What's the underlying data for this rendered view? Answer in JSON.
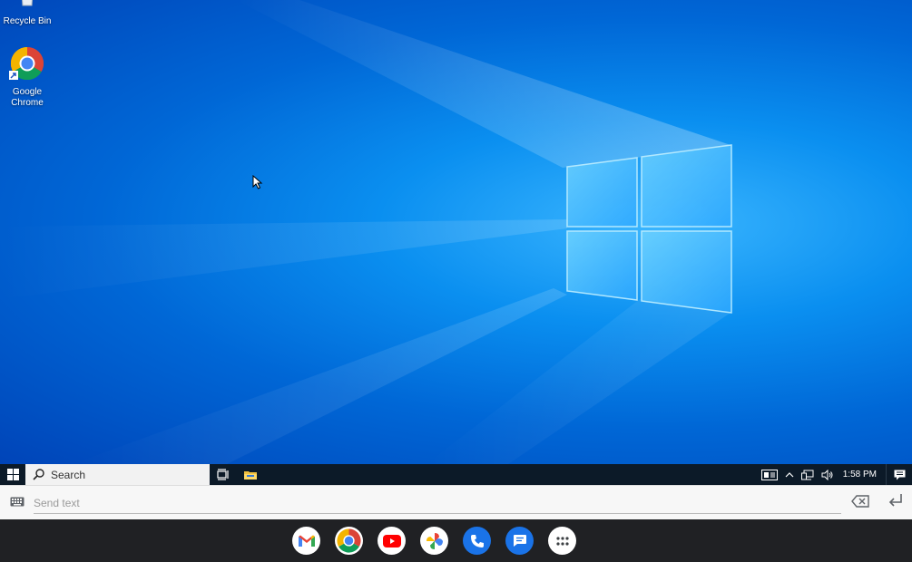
{
  "desktop": {
    "icons": [
      {
        "label": "Recycle Bin",
        "icon": "recycle-bin-icon"
      },
      {
        "label": "Google\nChrome",
        "icon": "chrome-icon"
      }
    ]
  },
  "taskbar": {
    "search_label": "Search",
    "clock": "1:58 PM"
  },
  "sendbar": {
    "placeholder": "Send text"
  },
  "dock": {
    "apps": [
      "gmail",
      "chrome",
      "youtube",
      "photos",
      "phone",
      "messages",
      "app-launcher"
    ]
  },
  "colors": {
    "desktop_blue": "#0078d7",
    "taskbar": "#0c1a28",
    "dock": "#202124",
    "phone_blue": "#1a73e8"
  }
}
